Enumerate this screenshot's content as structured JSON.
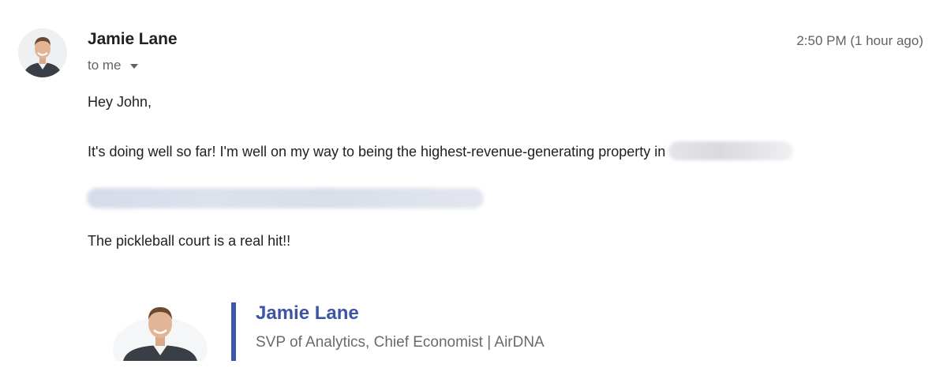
{
  "message": {
    "sender_name": "Jamie Lane",
    "recipient_label": "to me",
    "timestamp": "2:50 PM (1 hour ago)",
    "body": {
      "greeting": "Hey John,",
      "status_line": "It's doing well so far!  I'm well on my way to being the highest-revenue-generating property in",
      "pickleball_line": "The pickleball court is a real hit!!"
    }
  },
  "signature": {
    "name": "Jamie Lane",
    "title": "SVP of Analytics, Chief Economist | AirDNA"
  },
  "colors": {
    "signature_accent": "#3c55a5",
    "meta_text": "#5f6368",
    "body_text": "#202124"
  }
}
